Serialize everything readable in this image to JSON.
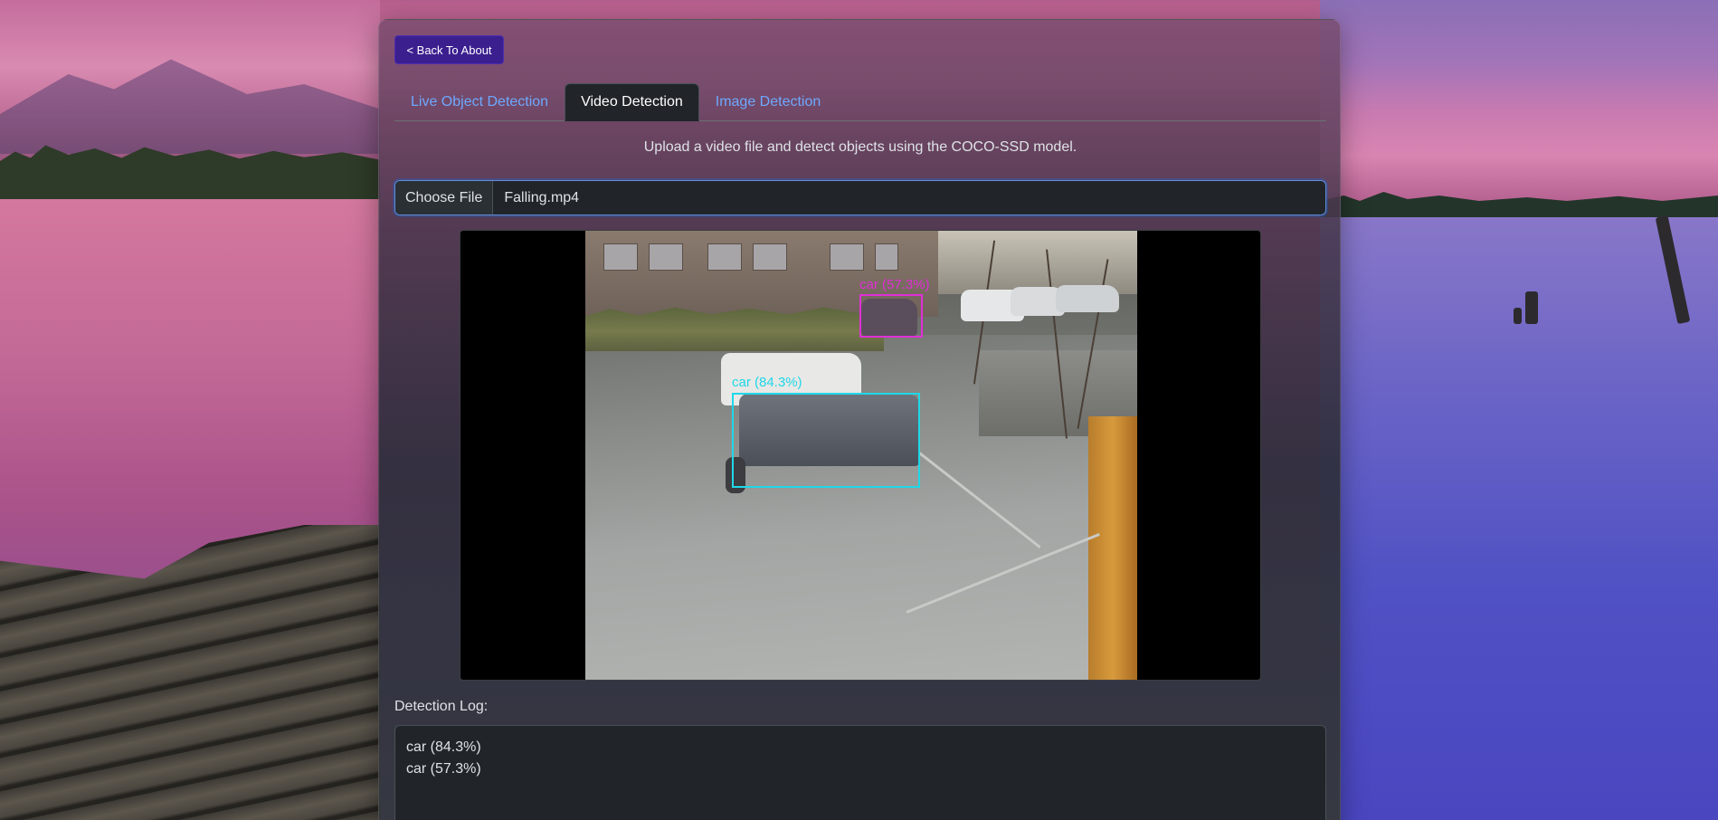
{
  "page": {
    "back_button_label": "< Back To About",
    "tabs": [
      {
        "label": "Live Object Detection",
        "active": false
      },
      {
        "label": "Video Detection",
        "active": true
      },
      {
        "label": "Image Detection",
        "active": false
      }
    ],
    "subtitle": "Upload a video file and detect objects using the COCO-SSD model.",
    "file_input": {
      "button_label": "Choose File",
      "file_name": "Falling.mp4"
    },
    "detections": [
      {
        "label": "car (84.3%)",
        "color": "#1fd8e8"
      },
      {
        "label": "car (57.3%)",
        "color": "#e02fd6"
      }
    ],
    "log": {
      "title": "Detection Log:",
      "entries": [
        "car (84.3%)",
        "car (57.3%)"
      ]
    }
  },
  "colors": {
    "accent_button": "#3b1f8f",
    "tab_link": "#6ea8fe",
    "panel_dark": "#212529"
  }
}
